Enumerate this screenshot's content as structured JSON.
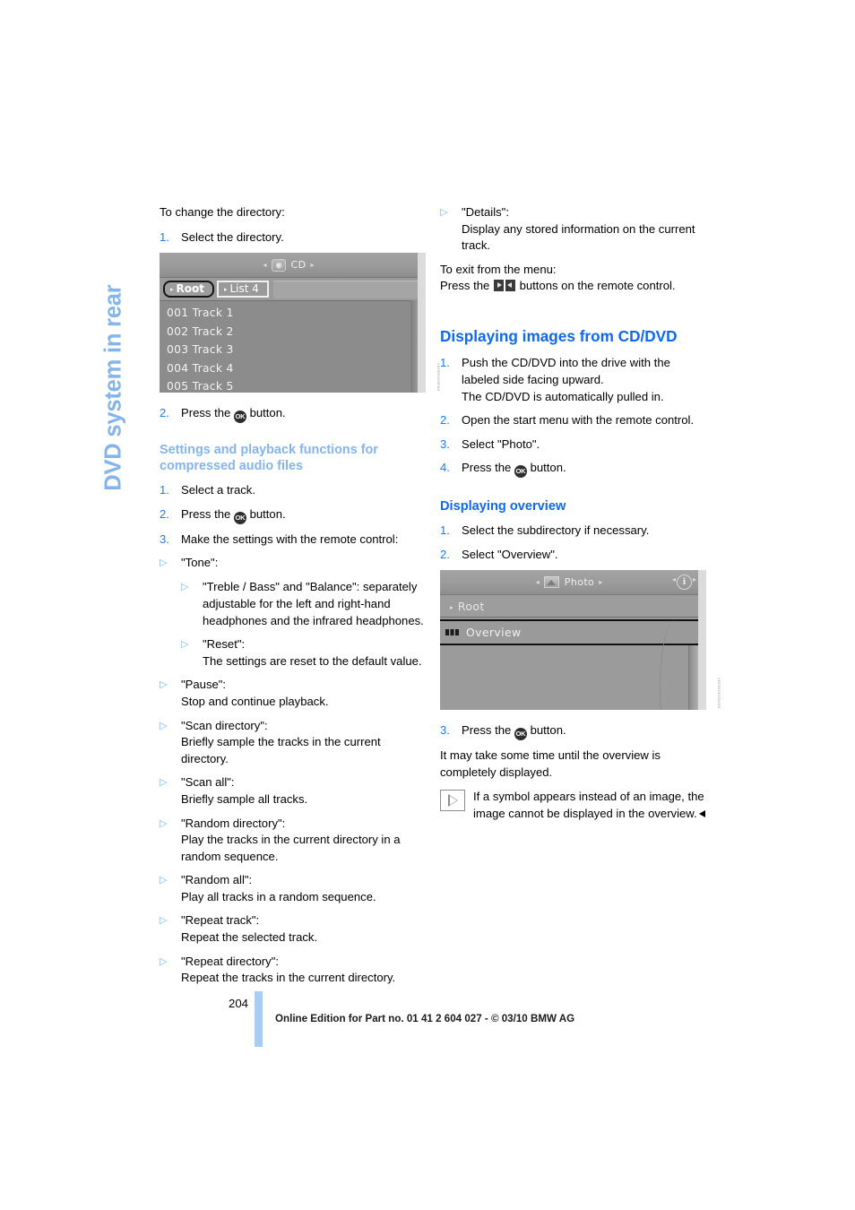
{
  "side_tab": {
    "label": "DVD system in rear"
  },
  "left_column": {
    "intro": "To change the directory:",
    "step1": {
      "num": "1.",
      "text": "Select the directory."
    },
    "screenshot_cd": {
      "caption_code": "VDF4D2005PHG",
      "top_label": "CD",
      "arrow_left": "◂",
      "arrow_right": "▸",
      "tab_root": "Root",
      "tab_list": "List 4",
      "caret": "▸",
      "rows": [
        "001 Track  1",
        "002 Track  2",
        "003 Track  3",
        "004 Track  4",
        "005 Track  5"
      ]
    },
    "step2": {
      "num": "2.",
      "pre": "Press the ",
      "ok": "OK",
      "post": " button."
    },
    "heading_settings": "Settings and playback functions for compressed audio files",
    "s1": {
      "num": "1.",
      "text": "Select a track."
    },
    "s2": {
      "num": "2.",
      "pre": "Press the ",
      "ok": "OK",
      "post": " button."
    },
    "s3": {
      "num": "3.",
      "text": "Make the settings with the remote control:"
    },
    "bullets": [
      {
        "mark": "▷",
        "title": "\"Tone\":",
        "desc": "",
        "sub": {
          "mark": "▷",
          "text": "\"Treble / Bass\" and \"Balance\": separately adjustable for the left and right-hand headphones and the infrared headphones."
        },
        "sub2": {
          "mark": "▷",
          "title": "\"Reset\":",
          "desc": "The settings are reset to the default value."
        }
      },
      {
        "mark": "▷",
        "title": "\"Pause\":",
        "desc": "Stop and continue playback."
      },
      {
        "mark": "▷",
        "title": "\"Scan directory\":",
        "desc": "Briefly sample the tracks in the current directory."
      },
      {
        "mark": "▷",
        "title": "\"Scan all\":",
        "desc": "Briefly sample all tracks."
      },
      {
        "mark": "▷",
        "title": "\"Random directory\":",
        "desc": "Play the tracks in the current directory in a random sequence."
      },
      {
        "mark": "▷",
        "title": "\"Random all\":",
        "desc": "Play all tracks in a random sequence."
      },
      {
        "mark": "▷",
        "title": "\"Repeat track\":",
        "desc": "Repeat the selected track."
      },
      {
        "mark": "▷",
        "title": "\"Repeat directory\":",
        "desc": "Repeat the tracks in the current directory."
      }
    ]
  },
  "right_column": {
    "details_bullet": {
      "mark": "▷",
      "title": "\"Details\":",
      "desc": "Display any stored information on the current track."
    },
    "exit_line1": "To exit from the menu:",
    "exit_pre": "Press the ",
    "exit_post": " buttons on the remote control.",
    "heading_displaying": "Displaying images from CD/DVD",
    "d1": {
      "num": "1.",
      "text": "Push the CD/DVD into the drive with the labeled side facing upward.",
      "extra": "The CD/DVD is automatically pulled in."
    },
    "d2": {
      "num": "2.",
      "text": "Open the start menu with the remote control."
    },
    "d3": {
      "num": "3.",
      "text": "Select \"Photo\"."
    },
    "d4": {
      "num": "4.",
      "pre": "Press the ",
      "ok": "OK",
      "post": " button."
    },
    "heading_overview": "Displaying overview",
    "o1": {
      "num": "1.",
      "text": "Select the subdirectory if necessary."
    },
    "o2": {
      "num": "2.",
      "text": "Select \"Overview\"."
    },
    "screenshot_photo": {
      "caption_code": "VDF3D2007DVD3",
      "top_label": "Photo",
      "arrow_left": "◂",
      "arrow_right": "▸",
      "info_glyph": "ℹ",
      "root_label": "Root",
      "caret": "▸",
      "overview_label": "Overview"
    },
    "o3": {
      "num": "3.",
      "pre": "Press the ",
      "ok": "OK",
      "post": " button."
    },
    "o3_extra": "It may take some time until the overview is completely displayed.",
    "note": "If a symbol appears instead of an image, the image cannot be displayed in the overview."
  },
  "footer": {
    "page_number": "204",
    "text": "Online Edition for Part no. 01 41 2 604 027 - © 03/10 BMW AG"
  },
  "colors": {
    "heading_strong": "#1068f0",
    "heading_light": "#85b4ea",
    "step_number": "#1f7bf0",
    "bullet_mark": "#7fb2ee",
    "footer_bar": "#a9cdf2"
  }
}
